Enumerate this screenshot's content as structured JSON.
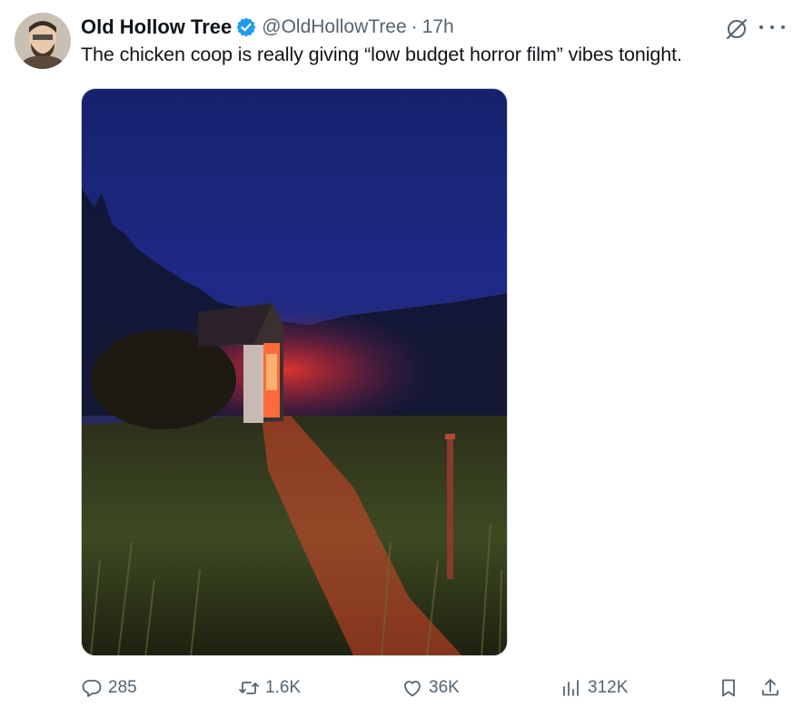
{
  "tweet": {
    "author_name": "Old Hollow Tree",
    "handle": "@OldHollowTree",
    "separator": "·",
    "time": "17h",
    "text": "The chicken coop is really giving “low budget horror film” vibes tonight."
  },
  "actions": {
    "replies": "285",
    "retweets": "1.6K",
    "likes": "36K",
    "views": "312K"
  },
  "colors": {
    "verified": "#1d9bf0",
    "muted": "#536471",
    "text": "#0f1419"
  },
  "icons": [
    "verified-badge-icon",
    "grok-icon",
    "more-icon",
    "reply-icon",
    "retweet-icon",
    "like-icon",
    "views-icon",
    "bookmark-icon",
    "share-icon"
  ]
}
